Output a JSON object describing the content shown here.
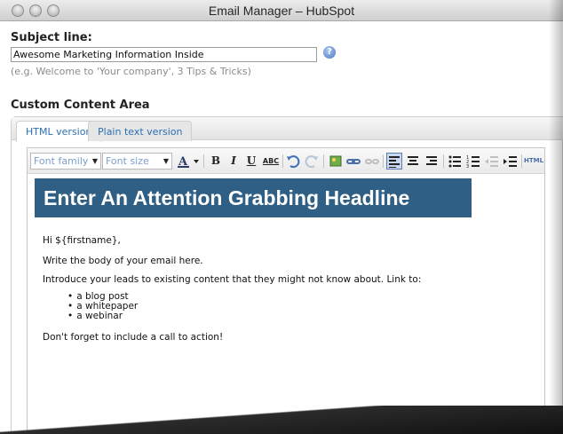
{
  "window": {
    "title": "Email Manager – HubSpot"
  },
  "subject": {
    "label": "Subject line:",
    "value": "Awesome Marketing Information Inside",
    "hint": "(e.g. Welcome to 'Your company', 3 Tips & Tricks)",
    "help_icon": "help-icon"
  },
  "content": {
    "label": "Custom Content Area",
    "tabs": [
      {
        "label": "HTML version",
        "active": true
      },
      {
        "label": "Plain text version",
        "active": false
      }
    ]
  },
  "toolbar": {
    "font_family": "Font family",
    "font_size": "Font size",
    "buttons": [
      "text-color-icon",
      "bold-icon",
      "italic-icon",
      "underline-icon",
      "spellcheck-icon",
      "undo-icon",
      "redo-icon",
      "insert-image-icon",
      "insert-link-icon",
      "unlink-icon",
      "align-left-icon",
      "align-center-icon",
      "align-right-icon",
      "bullet-list-icon",
      "numbered-list-icon",
      "outdent-icon",
      "indent-icon",
      "html-icon"
    ],
    "bold": "B",
    "italic": "I",
    "underline": "U",
    "spellcheck": "ABC",
    "html": "HTML"
  },
  "editor": {
    "headline": "Enter An Attention Grabbing Headline",
    "greeting": "Hi  ${firstname},",
    "line1": "Write the body of your email here.",
    "line2": "Introduce your leads to existing content that they might not know about. Link to:",
    "bullets": [
      "a blog post",
      "a whitepaper",
      "a webinar"
    ],
    "line3": "Don't forget to include a call to action!"
  },
  "colors": {
    "headline_bg": "#2f5f84",
    "tab_text": "#2d6fb2"
  }
}
